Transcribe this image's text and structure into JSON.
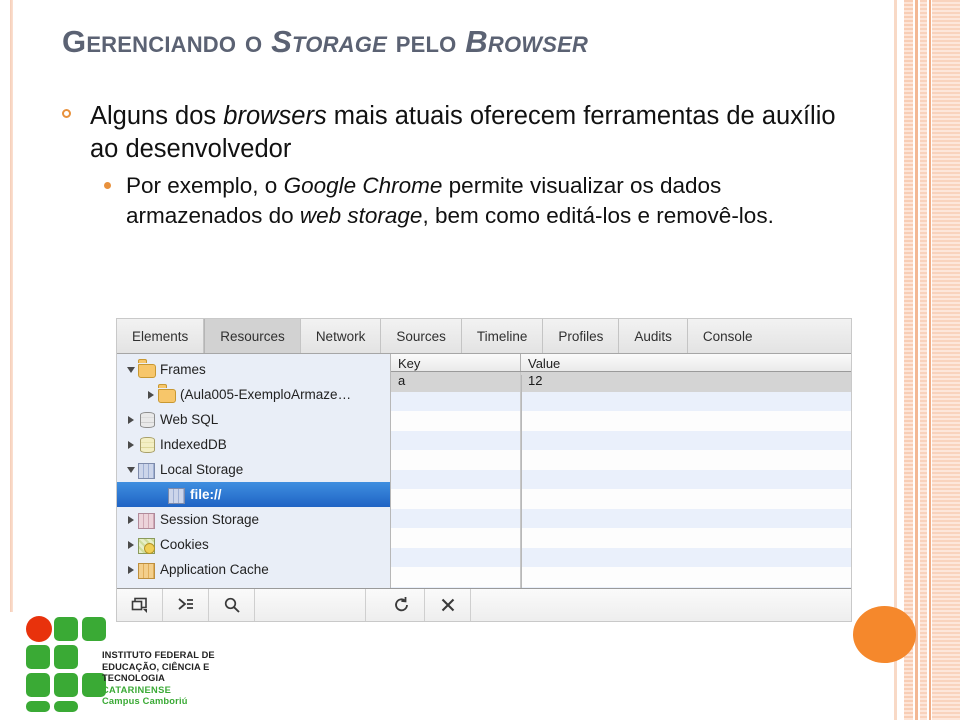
{
  "slide": {
    "title_parts": [
      {
        "text": "Gerenciando o ",
        "italic": false
      },
      {
        "text": "Storage",
        "italic": true
      },
      {
        "text": " pelo ",
        "italic": false
      },
      {
        "text": "Browser",
        "italic": true
      }
    ],
    "title_plain": "Gerenciando o Storage pelo Browser",
    "bullet1_parts": [
      {
        "text": "Alguns dos ",
        "italic": false
      },
      {
        "text": "browsers",
        "italic": true
      },
      {
        "text": " mais atuais oferecem ferramentas de auxílio ao desenvolvedor",
        "italic": false
      }
    ],
    "bullet1_plain": "Alguns dos browsers mais atuais oferecem ferramentas de auxílio ao desenvolvedor",
    "bullet2_parts": [
      {
        "text": "Por exemplo, o ",
        "italic": false
      },
      {
        "text": "Google Chrome",
        "italic": true
      },
      {
        "text": " permite visualizar os dados armazenados do ",
        "italic": false
      },
      {
        "text": "web storage",
        "italic": true
      },
      {
        "text": ", bem como editá-los e removê-los.",
        "italic": false
      }
    ],
    "bullet2_plain": "Por exemplo, o Google Chrome permite visualizar os dados armazenados do web storage, bem como editá-los e removê-los.",
    "colors": {
      "title": "#5b6273",
      "bullet_marker": "#e8913c",
      "accent_stripe": "#f3b894",
      "circle": "#f5882c"
    }
  },
  "logo": {
    "line1": "INSTITUTO FEDERAL DE",
    "line2": "EDUCAÇÃO, CIÊNCIA E TECNOLOGIA",
    "line3": "CATARINENSE",
    "line4": "Campus Camboriú",
    "green": "#3aaa35",
    "red": "#e8320c"
  },
  "devtools": {
    "tabs": [
      {
        "label": "Elements",
        "active": false
      },
      {
        "label": "Resources",
        "active": true
      },
      {
        "label": "Network",
        "active": false
      },
      {
        "label": "Sources",
        "active": false
      },
      {
        "label": "Timeline",
        "active": false
      },
      {
        "label": "Profiles",
        "active": false
      },
      {
        "label": "Audits",
        "active": false
      },
      {
        "label": "Console",
        "active": false
      }
    ],
    "tree": [
      {
        "label": "Frames",
        "icon": "folder-icon",
        "arrow": "down",
        "level": 1,
        "selected": false
      },
      {
        "label": "(Aula005-ExemploArmaze…",
        "icon": "folder-icon",
        "arrow": "right",
        "level": 2,
        "selected": false
      },
      {
        "label": "Web SQL",
        "icon": "database-icon",
        "arrow": "right",
        "level": 1,
        "selected": false
      },
      {
        "label": "IndexedDB",
        "icon": "database-yellow-icon",
        "arrow": "right",
        "level": 1,
        "selected": false
      },
      {
        "label": "Local Storage",
        "icon": "grid-blue-icon",
        "arrow": "down",
        "level": 1,
        "selected": false
      },
      {
        "label": "file://",
        "icon": "grid-blue-icon",
        "arrow": "none",
        "level": 3,
        "selected": true
      },
      {
        "label": "Session Storage",
        "icon": "grid-pink-icon",
        "arrow": "right",
        "level": 1,
        "selected": false
      },
      {
        "label": "Cookies",
        "icon": "cookie-icon",
        "arrow": "right",
        "level": 1,
        "selected": false
      },
      {
        "label": "Application Cache",
        "icon": "grid-orange-icon",
        "arrow": "right",
        "level": 1,
        "selected": false
      }
    ],
    "table": {
      "columns": [
        "Key",
        "Value"
      ],
      "rows": [
        [
          "a",
          "12"
        ]
      ],
      "empty_row_count": 11
    },
    "toolbar": [
      {
        "icon": "dock-panel-icon"
      },
      {
        "icon": "console-prompt-icon"
      },
      {
        "icon": "search-icon"
      },
      {
        "icon": "refresh-icon"
      },
      {
        "icon": "delete-icon"
      }
    ]
  }
}
